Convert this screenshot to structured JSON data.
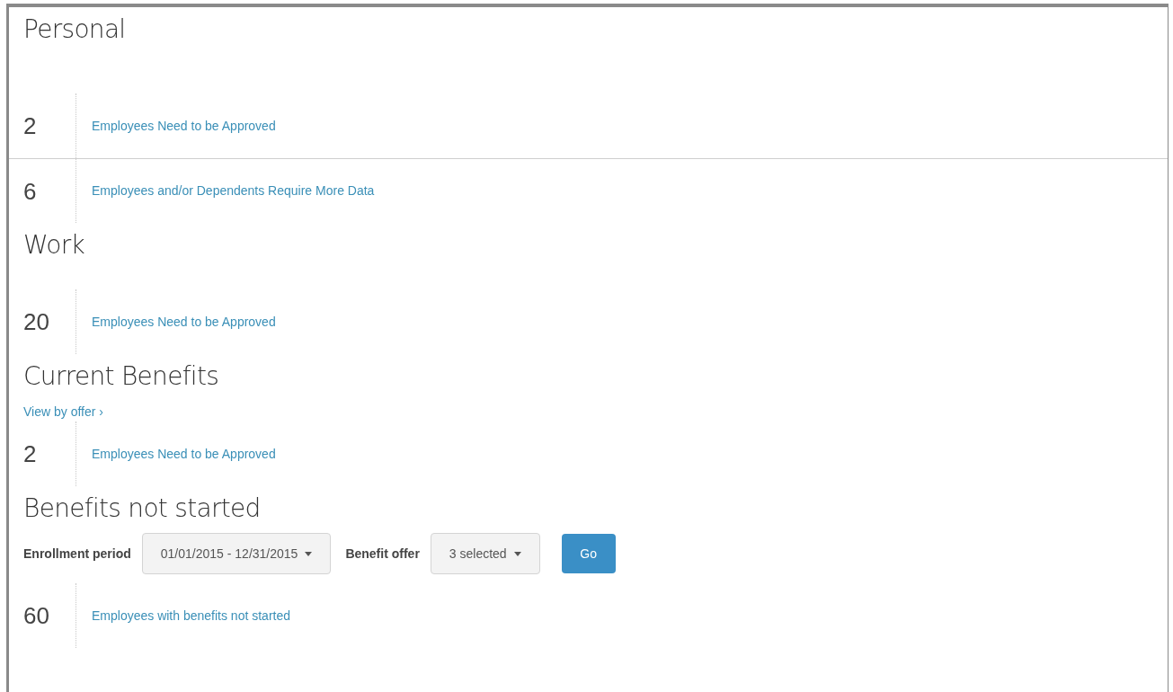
{
  "sections": [
    {
      "title": "Personal",
      "rows": [
        {
          "count": "2",
          "label": "Employees Need to be Approved"
        },
        {
          "count": "6",
          "label": "Employees and/or Dependents Require More Data"
        }
      ]
    },
    {
      "title": "Work",
      "rows": [
        {
          "count": "20",
          "label": "Employees Need to be Approved"
        }
      ]
    },
    {
      "title": "Current Benefits",
      "link": "View by offer ›",
      "rows": [
        {
          "count": "2",
          "label": "Employees Need to be Approved"
        }
      ]
    },
    {
      "title": "Benefits not started",
      "filters": [
        {
          "kind": "dropdown",
          "label": "Enrollment period",
          "value": "01/01/2015 - 12/31/2015"
        },
        {
          "kind": "dropdown",
          "label": "Benefit offer",
          "value": "3 selected"
        },
        {
          "kind": "button",
          "value": "Go"
        }
      ],
      "rows": [
        {
          "count": "60",
          "label": "Employees with benefits not started"
        }
      ]
    }
  ]
}
